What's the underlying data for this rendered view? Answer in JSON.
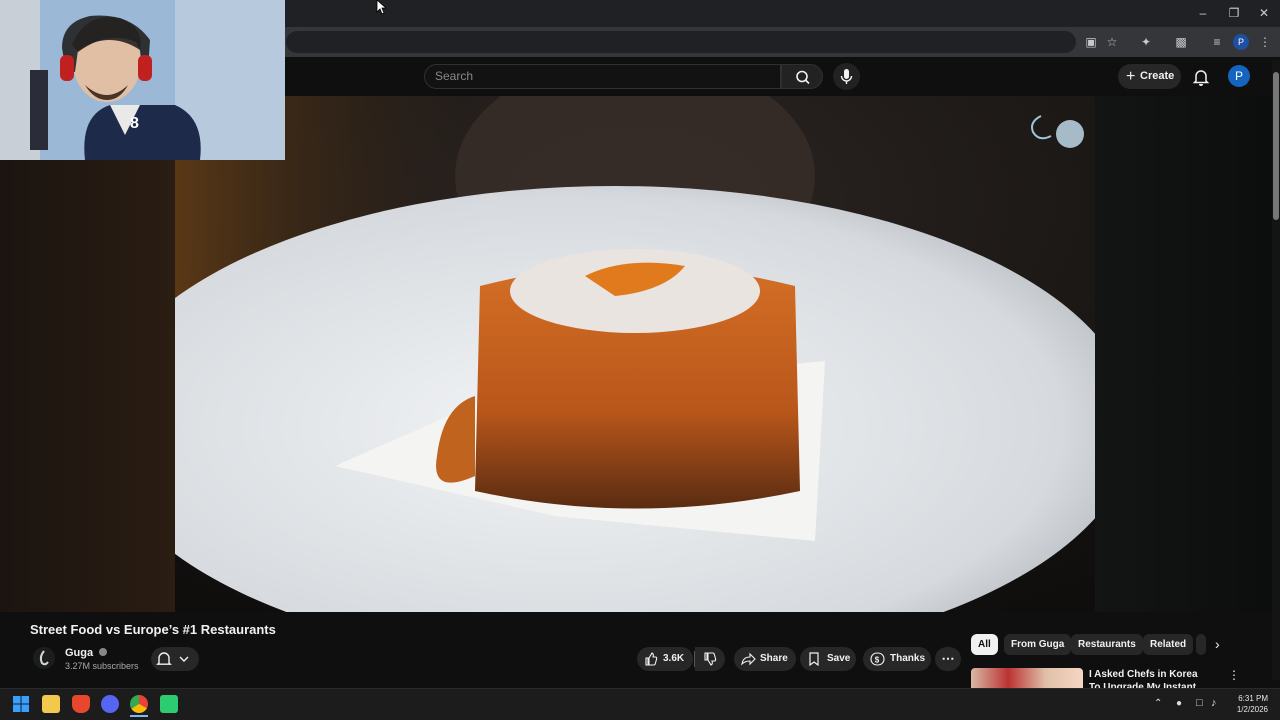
{
  "header": {
    "search_placeholder": "Search",
    "create_label": "Create",
    "avatar_letter": "P"
  },
  "browser": {
    "profile_letter": "P"
  },
  "video": {
    "title": "Street Food vs Europe’s #1 Restaurants"
  },
  "channel": {
    "name": "Guga",
    "subscribers": "3.27M subscribers"
  },
  "actions": {
    "likes": "3.6K",
    "share": "Share",
    "save": "Save",
    "thanks": "Thanks"
  },
  "chips": [
    "All",
    "From Guga",
    "Restaurants",
    "Related"
  ],
  "recommendation": {
    "title": "I Asked Chefs in Korea To Upgrade My Instant Ramen"
  },
  "taskbar": {
    "time": "6:31 PM",
    "date": "1/2/2026"
  },
  "colors": {
    "accent": "#1565c0",
    "background": "#0f0f0f",
    "pill": "#272727"
  }
}
